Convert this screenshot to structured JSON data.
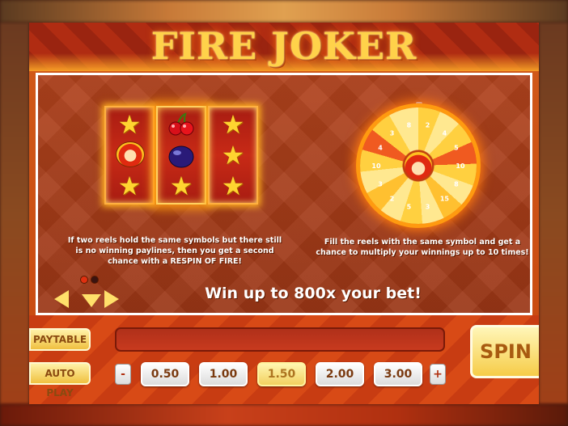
{
  "title": "FIRE JOKER",
  "info": {
    "left_text": "If two reels hold the same symbols but there still is no winning paylines, then you get a second chance with a RESPIN OF FIRE!",
    "right_text": "Fill the reels with the same symbol and get a chance to multiply your winnings up to 10 times!",
    "win_text": "Win up to 800x your bet!",
    "page_index": 1,
    "page_count": 2
  },
  "wheel": {
    "labels": [
      "2",
      "4",
      "5",
      "10",
      "8",
      "15",
      "3",
      "5",
      "2",
      "3",
      "10",
      "4",
      "3",
      "8"
    ]
  },
  "reels": [
    [
      "star-icon",
      "joker-icon",
      "star-icon"
    ],
    [
      "cherry-icon",
      "plum-icon",
      "star-icon"
    ],
    [
      "star-icon",
      "star-icon",
      "star-icon"
    ]
  ],
  "controls": {
    "paytable_label": "PAYTABLE",
    "autoplay_label": "AUTO PLAY",
    "spin_label": "SPIN",
    "minus_label": "-",
    "plus_label": "+",
    "bets": [
      "0.50",
      "1.00",
      "1.50",
      "2.00",
      "3.00"
    ],
    "selected_bet": "1.50"
  },
  "colors": {
    "accent_gold": "#ffd24a",
    "fire_orange": "#ff9a10",
    "panel_red": "#9a3616"
  }
}
